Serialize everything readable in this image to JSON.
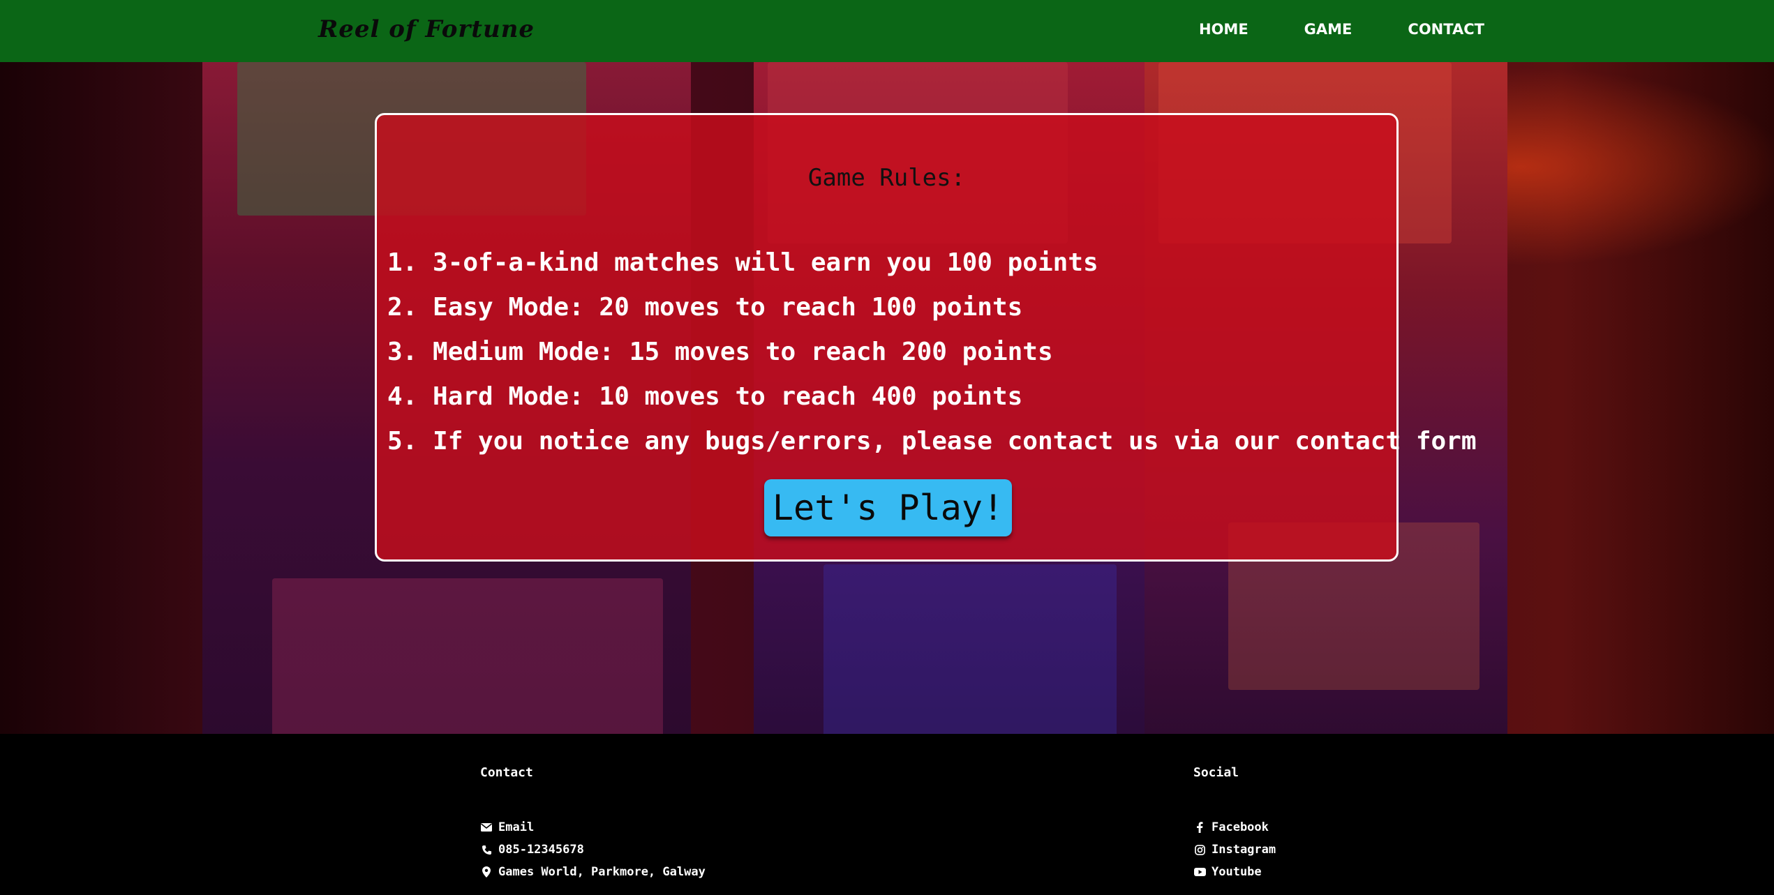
{
  "nav": {
    "brand": "Reel of Fortune",
    "links": [
      "HOME",
      "GAME",
      "CONTACT"
    ]
  },
  "rules": {
    "title": "Game Rules:",
    "items": [
      "1. 3-of-a-kind matches will earn you 100 points",
      "2. Easy Mode: 20 moves to reach 100 points",
      "3. Medium Mode: 15 moves to reach 200 points",
      "4. Hard Mode: 10 moves to reach 400 points",
      "5. If you notice any bugs/errors, please contact us via our contact form"
    ],
    "play_button": "Let's Play!"
  },
  "footer": {
    "contact": {
      "heading": "Contact",
      "email": "Email",
      "phone": "085-12345678",
      "address": "Games World, Parkmore, Galway"
    },
    "social": {
      "heading": "Social",
      "facebook": "Facebook",
      "instagram": "Instagram",
      "youtube": "Youtube"
    }
  },
  "colors": {
    "navbar": "#0b6616",
    "card": "#c80e1c",
    "play_button": "#37baf2",
    "footer": "#000000"
  }
}
